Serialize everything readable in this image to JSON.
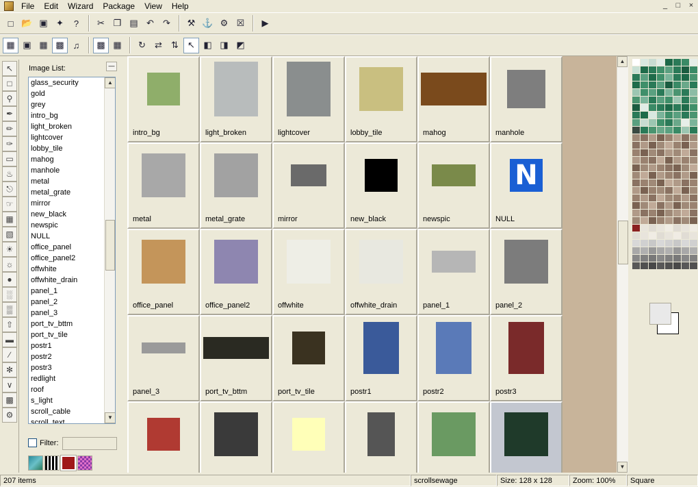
{
  "menu": [
    "File",
    "Edit",
    "Wizard",
    "Package",
    "View",
    "Help"
  ],
  "window_buttons": [
    "_",
    "□",
    "×"
  ],
  "image_list": {
    "label": "Image List:",
    "items": [
      "glass_security",
      "gold",
      "grey",
      "intro_bg",
      "light_broken",
      "lightcover",
      "lobby_tile",
      "mahog",
      "manhole",
      "metal",
      "metal_grate",
      "mirror",
      "new_black",
      "newspic",
      "NULL",
      "office_panel",
      "office_panel2",
      "offwhite",
      "offwhite_drain",
      "panel_1",
      "panel_2",
      "panel_3",
      "port_tv_bttm",
      "port_tv_tile",
      "postr1",
      "postr2",
      "postr3",
      "redlight",
      "roof",
      "s_light",
      "scroll_cable",
      "scroll_text"
    ],
    "filter_label": "Filter:",
    "filter_value": ""
  },
  "textures": [
    {
      "name": "intro_bg",
      "color": "#8fae6a"
    },
    {
      "name": "light_broken",
      "color": "#b8bcbc"
    },
    {
      "name": "lightcover",
      "color": "#8a8e8e"
    },
    {
      "name": "lobby_tile",
      "color": "#c9bf80"
    },
    {
      "name": "mahog",
      "color": "#7a4a1c"
    },
    {
      "name": "manhole",
      "color": "#7e7e7e"
    },
    {
      "name": "metal",
      "color": "#a8a8a8"
    },
    {
      "name": "metal_grate",
      "color": "#a2a2a2"
    },
    {
      "name": "mirror",
      "color": "#6a6a6a"
    },
    {
      "name": "new_black",
      "color": "#000000"
    },
    {
      "name": "newspic",
      "color": "#7a8a4a"
    },
    {
      "name": "NULL",
      "color": "#1a5fd4"
    },
    {
      "name": "office_panel",
      "color": "#c4955a"
    },
    {
      "name": "office_panel2",
      "color": "#8e86b0"
    },
    {
      "name": "offwhite",
      "color": "#eeeee6"
    },
    {
      "name": "offwhite_drain",
      "color": "#e8e8e0"
    },
    {
      "name": "panel_1",
      "color": "#b6b6b6"
    },
    {
      "name": "panel_2",
      "color": "#7c7c7c"
    },
    {
      "name": "panel_3",
      "color": "#9a9a9a"
    },
    {
      "name": "port_tv_bttm",
      "color": "#2a2a22"
    },
    {
      "name": "port_tv_tile",
      "color": "#3a3220"
    },
    {
      "name": "postr1",
      "color": "#3a5a9a"
    },
    {
      "name": "postr2",
      "color": "#5a7ab8"
    },
    {
      "name": "postr3",
      "color": "#7a2a2a"
    },
    {
      "name": "",
      "color": "#b03a32"
    },
    {
      "name": "",
      "color": "#3a3a3a"
    },
    {
      "name": "",
      "color": "#ffffb8"
    },
    {
      "name": "",
      "color": "#555555"
    },
    {
      "name": "",
      "color": "#6a9a62"
    },
    {
      "name": "",
      "color": "#1f3a2a"
    }
  ],
  "palette": [
    "#ffffff",
    "#d8e8e0",
    "#c8dcd2",
    "#e0ece6",
    "#1c6848",
    "#2a7a58",
    "#3a8a66",
    "#e6eee8",
    "#c8e0d4",
    "#1e6b4a",
    "#2a7a58",
    "#3f8f6a",
    "#5aa080",
    "#2a7a58",
    "#1a5c40",
    "#3a8a66",
    "#2a7a58",
    "#5aa080",
    "#1e6b4a",
    "#3f8f6a",
    "#7ab49a",
    "#2a7a58",
    "#1c6848",
    "#4a9470",
    "#1e6b4a",
    "#3f8f6a",
    "#2a7a58",
    "#5aa080",
    "#1a5c40",
    "#3a8a66",
    "#6aa88a",
    "#2a7a58",
    "#9cc6b2",
    "#3f8f6a",
    "#5aa080",
    "#2a7a58",
    "#7ab49a",
    "#4a9470",
    "#2a7a58",
    "#8cbca6",
    "#4a9470",
    "#7ab49a",
    "#2a7a58",
    "#5aa080",
    "#3f8f6a",
    "#9cc6b2",
    "#2a7a58",
    "#6aa88a",
    "#1a5c40",
    "#e0ece6",
    "#3a8a66",
    "#2a7a58",
    "#1c6848",
    "#2a7a58",
    "#1e6b4a",
    "#3f8f6a",
    "#2a7a58",
    "#1e6b4a",
    "#d8e8e0",
    "#7ab49a",
    "#3f8f6a",
    "#5aa080",
    "#2a7a58",
    "#4a9470",
    "#5aa080",
    "#c8dcd2",
    "#9cc6b2",
    "#3f8f6a",
    "#2a7a58",
    "#6aa88a",
    "#e6eee8",
    "#7ab49a",
    "#3a4a42",
    "#2a7a58",
    "#4a9470",
    "#6aa88a",
    "#5aa080",
    "#3a8a66",
    "#9cc6b2",
    "#2a7a58",
    "#a08a78",
    "#8a7262",
    "#b09a88",
    "#7a6252",
    "#9a8270",
    "#b8a290",
    "#8a7262",
    "#a08a78",
    "#8a7262",
    "#b09a88",
    "#7a6252",
    "#a08a78",
    "#c0aa98",
    "#9a8270",
    "#7a6252",
    "#b09a88",
    "#9a8270",
    "#7a6252",
    "#a08a78",
    "#8a7262",
    "#b09a88",
    "#a08a78",
    "#c0aa98",
    "#8a7262",
    "#b09a88",
    "#9a8270",
    "#8a7262",
    "#c0aa98",
    "#7a6252",
    "#b09a88",
    "#9a8270",
    "#a08a78",
    "#7a6252",
    "#a08a78",
    "#b09a88",
    "#9a8270",
    "#8a7262",
    "#7a6252",
    "#a08a78",
    "#c0aa98",
    "#a08a78",
    "#c0aa98",
    "#7a6252",
    "#b09a88",
    "#9a8270",
    "#8a7262",
    "#b09a88",
    "#7a6252",
    "#8a7262",
    "#9a8270",
    "#a08a78",
    "#7a6252",
    "#c0aa98",
    "#b09a88",
    "#8a7262",
    "#9a8270",
    "#b09a88",
    "#7a6252",
    "#9a8270",
    "#a08a78",
    "#8a7262",
    "#c0aa98",
    "#7a6252",
    "#a08a78",
    "#9a8270",
    "#b09a88",
    "#8a7262",
    "#c0aa98",
    "#a08a78",
    "#9a8270",
    "#b09a88",
    "#8a7262",
    "#7a6252",
    "#a08a78",
    "#c0aa98",
    "#8a7262",
    "#b09a88",
    "#7a6252",
    "#a08a78",
    "#9a8270",
    "#b09a88",
    "#8a7262",
    "#9a8270",
    "#7a6252",
    "#a08a78",
    "#b09a88",
    "#c0aa98",
    "#8a7262",
    "#a08a78",
    "#c0aa98",
    "#7a6252",
    "#9a8270",
    "#b09a88",
    "#8a7262",
    "#a08a78",
    "#7a6252",
    "#8a2020",
    "#e8e4dc",
    "#e0dcd4",
    "#e8e4dc",
    "#f0ece4",
    "#e0dcd4",
    "#e8e4dc",
    "#f0ece4",
    "#e0dcd4",
    "#e8e4dc",
    "#f0ece4",
    "#e0dcd4",
    "#e8e4dc",
    "#f0ece4",
    "#e0dcd4",
    "#e8e4dc",
    "#d8d8d8",
    "#d0d0d0",
    "#c8c8c8",
    "#d8d8d8",
    "#d0d0d0",
    "#c8c8c8",
    "#d8d8d8",
    "#d0d0d0",
    "#a8a8a8",
    "#b0b0b0",
    "#989898",
    "#a8a8a8",
    "#b0b0b0",
    "#989898",
    "#a8a8a8",
    "#b0b0b0",
    "#888888",
    "#808080",
    "#787878",
    "#888888",
    "#808080",
    "#787878",
    "#888888",
    "#808080",
    "#585858",
    "#505050",
    "#484848",
    "#585858",
    "#505050",
    "#484848",
    "#585858",
    "#505050"
  ],
  "status": {
    "items": "207 items",
    "name": "scrollsewage",
    "size": "Size: 128 x 128",
    "zoom": "Zoom: 100%",
    "mode": "Square"
  }
}
